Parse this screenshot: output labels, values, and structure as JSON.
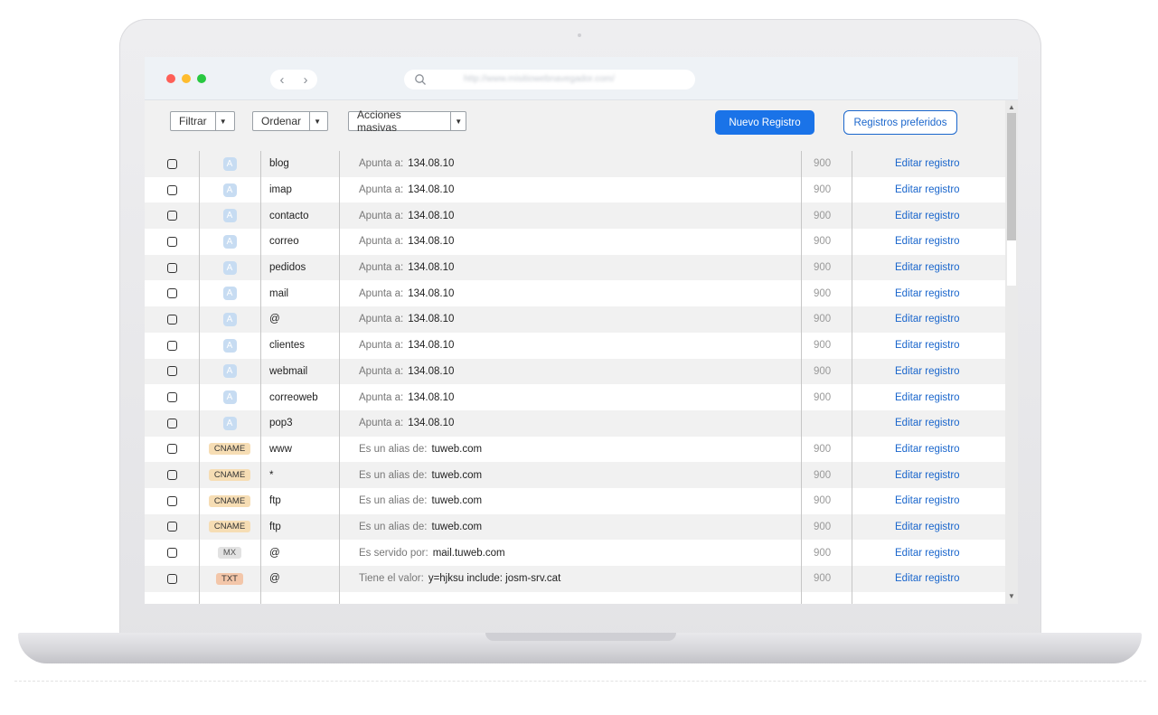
{
  "browser": {
    "back_icon": "‹",
    "forward_icon": "›",
    "url": "http://www.misitiowebnavegador.com/",
    "traffic_colors": [
      "#fe5f57",
      "#febc2e",
      "#28c840"
    ]
  },
  "toolbar": {
    "filter_label": "Filtrar",
    "sort_label": "Ordenar",
    "bulk_label": "Acciones masivas",
    "new_record_label": "Nuevo Registro",
    "favorites_label": "Registros preferidos"
  },
  "records": [
    {
      "type": "A",
      "name": "blog",
      "value_label": "Apunta a:",
      "value": "134.08.10",
      "ttl": "900",
      "action": "Editar registro"
    },
    {
      "type": "A",
      "name": "imap",
      "value_label": "Apunta a:",
      "value": "134.08.10",
      "ttl": "900",
      "action": "Editar registro"
    },
    {
      "type": "A",
      "name": "contacto",
      "value_label": "Apunta a:",
      "value": "134.08.10",
      "ttl": "900",
      "action": "Editar registro"
    },
    {
      "type": "A",
      "name": "correo",
      "value_label": "Apunta a:",
      "value": "134.08.10",
      "ttl": "900",
      "action": "Editar registro"
    },
    {
      "type": "A",
      "name": "pedidos",
      "value_label": "Apunta a:",
      "value": "134.08.10",
      "ttl": "900",
      "action": "Editar registro"
    },
    {
      "type": "A",
      "name": "mail",
      "value_label": "Apunta a:",
      "value": "134.08.10",
      "ttl": "900",
      "action": "Editar registro"
    },
    {
      "type": "A",
      "name": "@",
      "value_label": "Apunta a:",
      "value": "134.08.10",
      "ttl": "900",
      "action": "Editar registro"
    },
    {
      "type": "A",
      "name": "clientes",
      "value_label": "Apunta a:",
      "value": "134.08.10",
      "ttl": "900",
      "action": "Editar registro"
    },
    {
      "type": "A",
      "name": "webmail",
      "value_label": "Apunta a:",
      "value": "134.08.10",
      "ttl": "900",
      "action": "Editar registro"
    },
    {
      "type": "A",
      "name": "correoweb",
      "value_label": "Apunta a:",
      "value": "134.08.10",
      "ttl": "900",
      "action": "Editar registro"
    },
    {
      "type": "A",
      "name": "pop3",
      "value_label": "Apunta a:",
      "value": "134.08.10",
      "ttl": "",
      "action": "Editar registro"
    },
    {
      "type": "CNAME",
      "name": "www",
      "value_label": "Es un alias de:",
      "value": "tuweb.com",
      "ttl": "900",
      "action": "Editar registro"
    },
    {
      "type": "CNAME",
      "name": "*",
      "value_label": "Es un alias de:",
      "value": "tuweb.com",
      "ttl": "900",
      "action": "Editar registro"
    },
    {
      "type": "CNAME",
      "name": "ftp",
      "value_label": "Es un alias de:",
      "value": "tuweb.com",
      "ttl": "900",
      "action": "Editar registro"
    },
    {
      "type": "CNAME",
      "name": "ftp",
      "value_label": "Es un alias de:",
      "value": "tuweb.com",
      "ttl": "900",
      "action": "Editar registro"
    },
    {
      "type": "MX",
      "name": "@",
      "value_label": "Es servido por:",
      "value": "mail.tuweb.com",
      "ttl": "900",
      "action": "Editar registro"
    },
    {
      "type": "TXT",
      "name": "@",
      "value_label": "Tiene el valor:",
      "value": "y=hjksu include: josm-srv.cat",
      "ttl": "900",
      "action": "Editar registro"
    }
  ]
}
